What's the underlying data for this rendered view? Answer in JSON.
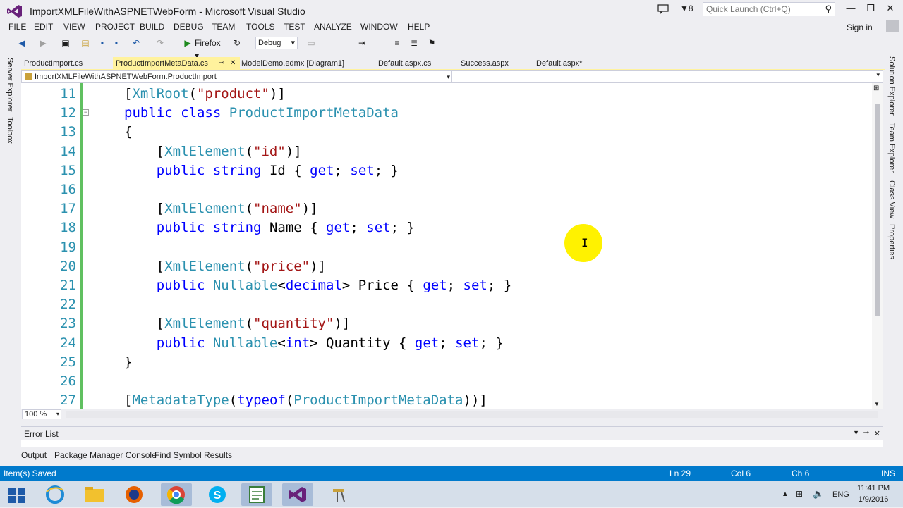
{
  "window": {
    "title": "ImportXMLFileWithASPNETWebForm - Microsoft Visual Studio",
    "notification_count": "8",
    "quick_launch_placeholder": "Quick Launch (Ctrl+Q)",
    "sign_in": "Sign in"
  },
  "menu": [
    "FILE",
    "EDIT",
    "VIEW",
    "PROJECT",
    "BUILD",
    "DEBUG",
    "TEAM",
    "TOOLS",
    "TEST",
    "ANALYZE",
    "WINDOW",
    "HELP"
  ],
  "toolbar": {
    "browser": "Firefox",
    "configuration": "Debug"
  },
  "left_panels": [
    "Server Explorer",
    "Toolbox"
  ],
  "right_panels": [
    "Solution Explorer",
    "Team Explorer",
    "Class View",
    "Properties"
  ],
  "tabs": [
    {
      "label": "ProductImport.cs",
      "active": false
    },
    {
      "label": "ProductImportMetaData.cs",
      "active": true
    },
    {
      "label": "ModelDemo.edmx [Diagram1]",
      "active": false
    },
    {
      "label": "Default.aspx.cs",
      "active": false
    },
    {
      "label": "Success.aspx",
      "active": false
    },
    {
      "label": "Default.aspx*",
      "active": false
    }
  ],
  "navbar": {
    "type_selector": "ImportXMLFileWithASPNETWebForm.ProductImport"
  },
  "editor": {
    "zoom": "100 %",
    "lines": [
      {
        "num": "11",
        "code": "[XmlRoot(\"product\")]"
      },
      {
        "num": "12",
        "code": "public class ProductImportMetaData"
      },
      {
        "num": "13",
        "code": "{"
      },
      {
        "num": "14",
        "code": "    [XmlElement(\"id\")]"
      },
      {
        "num": "15",
        "code": "    public string Id { get; set; }"
      },
      {
        "num": "16",
        "code": ""
      },
      {
        "num": "17",
        "code": "    [XmlElement(\"name\")]"
      },
      {
        "num": "18",
        "code": "    public string Name { get; set; }"
      },
      {
        "num": "19",
        "code": ""
      },
      {
        "num": "20",
        "code": "    [XmlElement(\"price\")]"
      },
      {
        "num": "21",
        "code": "    public Nullable<decimal> Price { get; set; }"
      },
      {
        "num": "22",
        "code": ""
      },
      {
        "num": "23",
        "code": "    [XmlElement(\"quantity\")]"
      },
      {
        "num": "24",
        "code": "    public Nullable<int> Quantity { get; set; }"
      },
      {
        "num": "25",
        "code": "}"
      },
      {
        "num": "26",
        "code": ""
      },
      {
        "num": "27",
        "code": "[MetadataType(typeof(ProductImportMetaData))]"
      }
    ]
  },
  "bottom_panel": {
    "title": "Error List",
    "tabs": [
      "Output",
      "Package Manager Console",
      "Find Symbol Results"
    ]
  },
  "status": {
    "message": "Item(s) Saved",
    "line": "Ln 29",
    "col": "Col 6",
    "ch": "Ch 6",
    "mode": "INS"
  },
  "taskbar": {
    "language": "ENG",
    "time": "11:41 PM",
    "date": "1/9/2016"
  },
  "colors": {
    "status_bar": "#007ACC",
    "active_tab": "#FFF29D",
    "keyword": "#0000FF",
    "type": "#2B91AF",
    "string": "#A31515"
  }
}
